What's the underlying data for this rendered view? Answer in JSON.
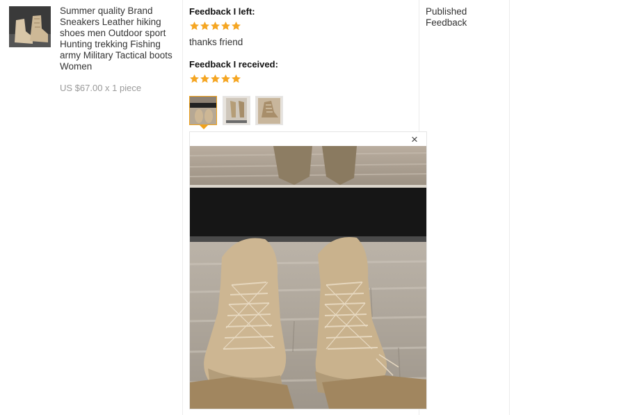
{
  "product": {
    "title": "Summer quality Brand Sneakers Leather hiking shoes men Outdoor sport Hunting trekking Fishing army Military Tactical boots Women",
    "price": "US $67.00 x 1 piece",
    "image_icon": "boot-product-icon"
  },
  "feedback_left": {
    "label": "Feedback I left:",
    "rating": 5,
    "text": "thanks friend"
  },
  "feedback_received": {
    "label": "Feedback I received:",
    "rating": 5
  },
  "status": {
    "line1": "Published",
    "line2": "Feedback"
  },
  "photos": {
    "count": 3,
    "active_index": 0,
    "close_symbol": "×"
  },
  "colors": {
    "star": "#f5a623",
    "active_border": "#f0a21c",
    "price_text": "#999999"
  }
}
